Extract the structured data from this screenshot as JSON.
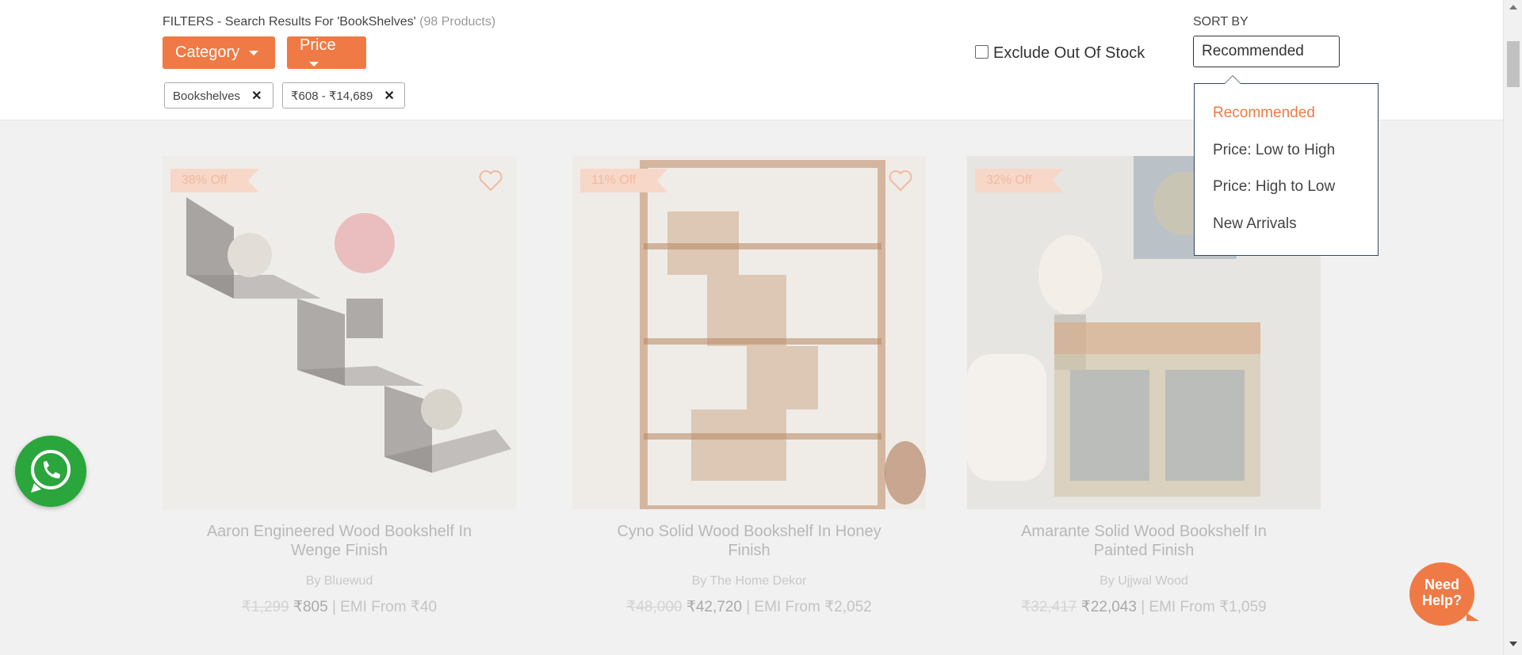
{
  "header": {
    "filters_prefix": "FILTERS - Search Results For 'BookShelves'",
    "filters_count": "(98 Products)",
    "category_button": "Category",
    "price_button": "Price",
    "active_filters": [
      {
        "label": "Bookshelves",
        "remove": "✕"
      },
      {
        "label": "₹608 - ₹14,689",
        "remove": "✕"
      }
    ],
    "exclude_out_of_stock": "Exclude Out Of Stock",
    "sort_label": "SORT BY",
    "sort_selected": "Recommended",
    "sort_options": [
      "Recommended",
      "Price: Low to High",
      "Price: High to Low",
      "New Arrivals"
    ]
  },
  "products": [
    {
      "discount": "38% Off",
      "title": "Aaron Engineered Wood Bookshelf In Wenge Finish",
      "brand": "By Bluewud",
      "mrp": "₹1,299",
      "price": "₹805",
      "emi": "| EMI From ₹40",
      "wishlist_icon": "heart-outline-icon"
    },
    {
      "discount": "11% Off",
      "title": "Cyno Solid Wood Bookshelf In Honey Finish",
      "brand": "By The Home Dekor",
      "mrp": "₹48,000",
      "price": "₹42,720",
      "emi": "| EMI From ₹2,052",
      "wishlist_icon": "heart-outline-icon"
    },
    {
      "discount": "32% Off",
      "title": "Amarante Solid Wood Bookshelf In Painted Finish",
      "brand": "By Ujjwal Wood",
      "mrp": "₹32,417",
      "price": "₹22,043",
      "emi": "| EMI From ₹1,059",
      "wishlist_icon": "heart-outline-icon"
    }
  ],
  "widgets": {
    "whatsapp_icon": "whatsapp-icon",
    "help_label": "Need Help?"
  },
  "colors": {
    "accent": "#ef7a45",
    "whatsapp": "#2aa63c",
    "menu_border": "#33475e"
  }
}
